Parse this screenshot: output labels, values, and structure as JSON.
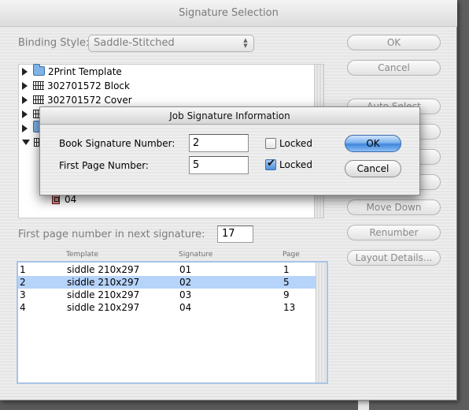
{
  "window": {
    "title": "Signature Selection"
  },
  "binding": {
    "label": "Binding Style:",
    "value": "Saddle-Stitched"
  },
  "buttons": {
    "ok": "OK",
    "cancel": "Cancel",
    "auto_select": "Auto Select",
    "move_down": "Move Down",
    "renumber": "Renumber",
    "layout_details": "Layout Details..."
  },
  "tree": {
    "items": [
      {
        "label": "2Print Template",
        "icon": "folder-icon"
      },
      {
        "label": "302701572 Block",
        "icon": "grid-icon"
      },
      {
        "label": "302701572 Cover",
        "icon": "grid-icon"
      },
      {
        "label": "04",
        "icon": "page-icon"
      }
    ]
  },
  "next_signature": {
    "label": "First page number in next signature:",
    "value": "17"
  },
  "table": {
    "headers": {
      "template": "Template",
      "signature": "Signature",
      "page": "Page"
    },
    "rows": [
      {
        "num": "1",
        "template": "siddle 210x297",
        "signature": "01",
        "page": "1"
      },
      {
        "num": "2",
        "template": "siddle 210x297",
        "signature": "02",
        "page": "5"
      },
      {
        "num": "3",
        "template": "siddle 210x297",
        "signature": "03",
        "page": "9"
      },
      {
        "num": "4",
        "template": "siddle 210x297",
        "signature": "04",
        "page": "13"
      }
    ],
    "selected_index": 1
  },
  "job_dialog": {
    "title": "Job Signature Information",
    "book_sig_label": "Book Signature Number:",
    "book_sig_value": "2",
    "first_page_label": "First Page Number:",
    "first_page_value": "5",
    "locked_label": "Locked",
    "book_sig_locked": false,
    "first_page_locked": true,
    "ok": "OK",
    "cancel": "Cancel"
  },
  "colors": {
    "selection": "#b6d3fa",
    "default_button": "#3f86dd",
    "table_border": "#a9c4e6"
  }
}
